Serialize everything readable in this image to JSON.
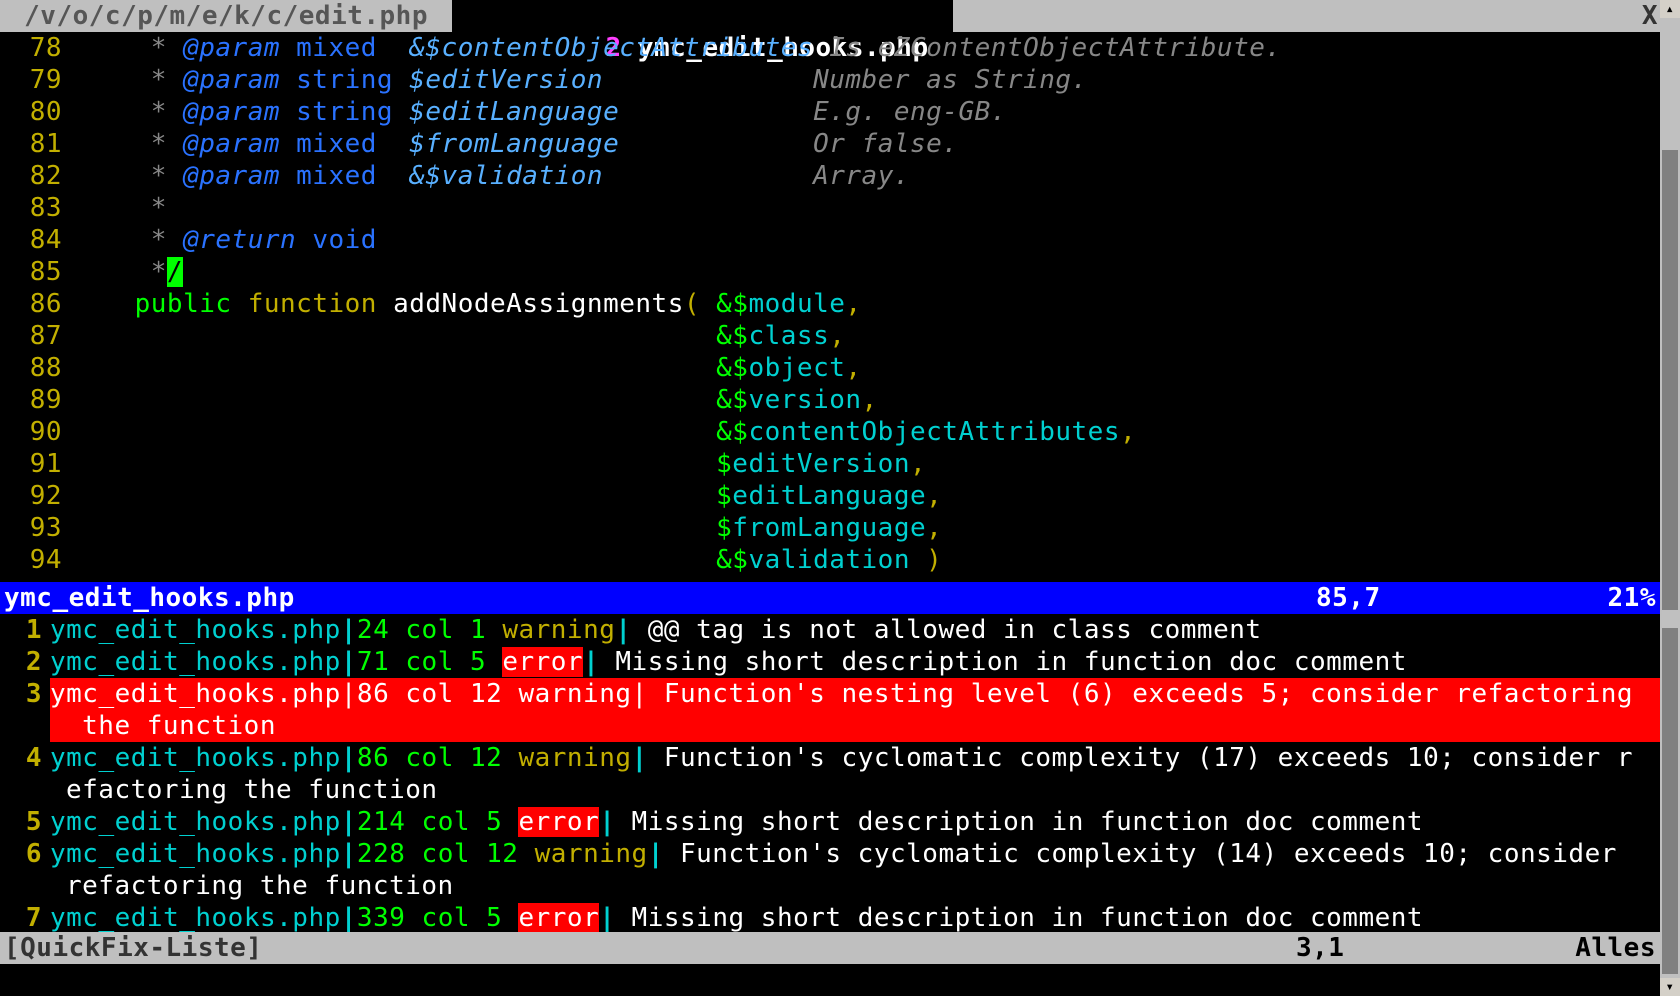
{
  "tabs": {
    "inactive": {
      "label": " /v/o/c/p/m/e/k/c/edit.php "
    },
    "active": {
      "num": " 2 ",
      "label": "ymc_edit_hooks.php "
    },
    "close": "X"
  },
  "code": {
    "lines": [
      {
        "n": "78",
        "seg": [
          {
            "c": "c-comment",
            "t": "     * "
          },
          {
            "c": "c-tag",
            "t": "@param "
          },
          {
            "c": "c-type",
            "t": "mixed  "
          },
          {
            "c": "c-varblue",
            "t": "&$contentObjectAttributes "
          },
          {
            "c": "c-comment",
            "t": "Is eZContentObjectAttribute."
          }
        ]
      },
      {
        "n": "79",
        "seg": [
          {
            "c": "c-comment",
            "t": "     * "
          },
          {
            "c": "c-tag",
            "t": "@param "
          },
          {
            "c": "c-type",
            "t": "string "
          },
          {
            "c": "c-varblue",
            "t": "$editVersion             "
          },
          {
            "c": "c-comment",
            "t": "Number as String."
          }
        ]
      },
      {
        "n": "80",
        "seg": [
          {
            "c": "c-comment",
            "t": "     * "
          },
          {
            "c": "c-tag",
            "t": "@param "
          },
          {
            "c": "c-type",
            "t": "string "
          },
          {
            "c": "c-varblue",
            "t": "$editLanguage            "
          },
          {
            "c": "c-comment",
            "t": "E.g. eng-GB."
          }
        ]
      },
      {
        "n": "81",
        "seg": [
          {
            "c": "c-comment",
            "t": "     * "
          },
          {
            "c": "c-tag",
            "t": "@param "
          },
          {
            "c": "c-type",
            "t": "mixed  "
          },
          {
            "c": "c-varblue",
            "t": "$fromLanguage            "
          },
          {
            "c": "c-comment",
            "t": "Or false."
          }
        ]
      },
      {
        "n": "82",
        "seg": [
          {
            "c": "c-comment",
            "t": "     * "
          },
          {
            "c": "c-tag",
            "t": "@param "
          },
          {
            "c": "c-type",
            "t": "mixed  "
          },
          {
            "c": "c-varblue",
            "t": "&$validation             "
          },
          {
            "c": "c-comment",
            "t": "Array."
          }
        ]
      },
      {
        "n": "83",
        "seg": [
          {
            "c": "c-comment",
            "t": "     *"
          }
        ]
      },
      {
        "n": "84",
        "seg": [
          {
            "c": "c-comment",
            "t": "     * "
          },
          {
            "c": "c-tag",
            "t": "@return "
          },
          {
            "c": "c-type",
            "t": "void"
          }
        ]
      },
      {
        "n": "85",
        "seg": [
          {
            "c": "c-comment",
            "t": "     *"
          },
          {
            "c": "cursor",
            "t": "/"
          }
        ]
      },
      {
        "n": "86",
        "seg": [
          {
            "c": "c-ident",
            "t": "    "
          },
          {
            "c": "c-kw",
            "t": "public"
          },
          {
            "c": "c-ident",
            "t": " "
          },
          {
            "c": "c-kw2",
            "t": "function"
          },
          {
            "c": "c-ident",
            "t": " addNodeAssignments"
          },
          {
            "c": "c-paren",
            "t": "("
          },
          {
            "c": "c-ident",
            "t": " "
          },
          {
            "c": "c-amp",
            "t": "&"
          },
          {
            "c": "c-dollar",
            "t": "$"
          },
          {
            "c": "c-var",
            "t": "module"
          },
          {
            "c": "c-op",
            "t": ","
          }
        ]
      },
      {
        "n": "87",
        "seg": [
          {
            "c": "c-ident",
            "t": "                                        "
          },
          {
            "c": "c-amp",
            "t": "&"
          },
          {
            "c": "c-dollar",
            "t": "$"
          },
          {
            "c": "c-var",
            "t": "class"
          },
          {
            "c": "c-op",
            "t": ","
          }
        ]
      },
      {
        "n": "88",
        "seg": [
          {
            "c": "c-ident",
            "t": "                                        "
          },
          {
            "c": "c-amp",
            "t": "&"
          },
          {
            "c": "c-dollar",
            "t": "$"
          },
          {
            "c": "c-var",
            "t": "object"
          },
          {
            "c": "c-op",
            "t": ","
          }
        ]
      },
      {
        "n": "89",
        "seg": [
          {
            "c": "c-ident",
            "t": "                                        "
          },
          {
            "c": "c-amp",
            "t": "&"
          },
          {
            "c": "c-dollar",
            "t": "$"
          },
          {
            "c": "c-var",
            "t": "version"
          },
          {
            "c": "c-op",
            "t": ","
          }
        ]
      },
      {
        "n": "90",
        "seg": [
          {
            "c": "c-ident",
            "t": "                                        "
          },
          {
            "c": "c-amp",
            "t": "&"
          },
          {
            "c": "c-dollar",
            "t": "$"
          },
          {
            "c": "c-var",
            "t": "contentObjectAttributes"
          },
          {
            "c": "c-op",
            "t": ","
          }
        ]
      },
      {
        "n": "91",
        "seg": [
          {
            "c": "c-ident",
            "t": "                                        "
          },
          {
            "c": "c-dollar",
            "t": "$"
          },
          {
            "c": "c-var",
            "t": "editVersion"
          },
          {
            "c": "c-op",
            "t": ","
          }
        ]
      },
      {
        "n": "92",
        "seg": [
          {
            "c": "c-ident",
            "t": "                                        "
          },
          {
            "c": "c-dollar",
            "t": "$"
          },
          {
            "c": "c-var",
            "t": "editLanguage"
          },
          {
            "c": "c-op",
            "t": ","
          }
        ]
      },
      {
        "n": "93",
        "seg": [
          {
            "c": "c-ident",
            "t": "                                        "
          },
          {
            "c": "c-dollar",
            "t": "$"
          },
          {
            "c": "c-var",
            "t": "fromLanguage"
          },
          {
            "c": "c-op",
            "t": ","
          }
        ]
      },
      {
        "n": "94",
        "seg": [
          {
            "c": "c-ident",
            "t": "                                        "
          },
          {
            "c": "c-amp",
            "t": "&"
          },
          {
            "c": "c-dollar",
            "t": "$"
          },
          {
            "c": "c-var",
            "t": "validation"
          },
          {
            "c": "c-ident",
            "t": " "
          },
          {
            "c": "c-paren",
            "t": ")"
          }
        ]
      }
    ]
  },
  "status": {
    "filename": "ymc_edit_hooks.php",
    "position": "85,7",
    "percent": "21%"
  },
  "quickfix": {
    "items": [
      {
        "n": "1",
        "selected": false,
        "file": "ymc_edit_hooks.php",
        "loc": "24 col 1 ",
        "kindClass": "qf-warn",
        "kind": "warning",
        "msg": " @@ tag is not allowed in class comment",
        "wrap": ""
      },
      {
        "n": "2",
        "selected": false,
        "file": "ymc_edit_hooks.php",
        "loc": "71 col 5 ",
        "kindClass": "qf-err",
        "kind": "error",
        "msg": " Missing short description in function doc comment",
        "wrap": ""
      },
      {
        "n": "3",
        "selected": true,
        "file": "ymc_edit_hooks.php",
        "loc": "86 col 12 ",
        "kindClass": "qf-warn",
        "kind": "warning",
        "msg": " Function's nesting level (6) exceeds 5; consider refactoring",
        "wrap": " the function"
      },
      {
        "n": "4",
        "selected": false,
        "file": "ymc_edit_hooks.php",
        "loc": "86 col 12 ",
        "kindClass": "qf-warn",
        "kind": "warning",
        "msg": " Function's cyclomatic complexity (17) exceeds 10; consider r",
        "wrap": "efactoring the function"
      },
      {
        "n": "5",
        "selected": false,
        "file": "ymc_edit_hooks.php",
        "loc": "214 col 5 ",
        "kindClass": "qf-err",
        "kind": "error",
        "msg": " Missing short description in function doc comment",
        "wrap": ""
      },
      {
        "n": "6",
        "selected": false,
        "file": "ymc_edit_hooks.php",
        "loc": "228 col 12 ",
        "kindClass": "qf-warn",
        "kind": "warning",
        "msg": " Function's cyclomatic complexity (14) exceeds 10; consider ",
        "wrap": "refactoring the function"
      },
      {
        "n": "7",
        "selected": false,
        "file": "ymc_edit_hooks.php",
        "loc": "339 col 5 ",
        "kindClass": "qf-err",
        "kind": "error",
        "msg": " Missing short description in function doc comment",
        "wrap": ""
      }
    ]
  },
  "qfstatus": {
    "title": "[QuickFix-Liste]",
    "position": "3,1",
    "percent": "Alles"
  }
}
